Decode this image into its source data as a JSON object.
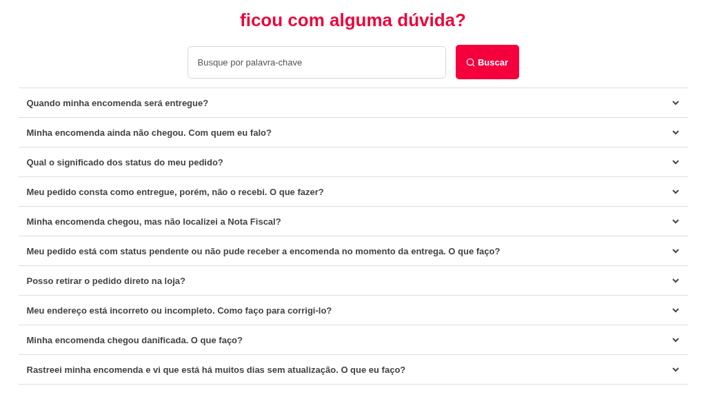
{
  "title": "ficou com alguma dúvida?",
  "search": {
    "placeholder": "Busque por palavra-chave",
    "button": "Buscar"
  },
  "faq": [
    {
      "question": "Quando minha encomenda será entregue?"
    },
    {
      "question": "Minha encomenda ainda não chegou. Com quem eu falo?"
    },
    {
      "question": "Qual o significado dos status do meu pedido?"
    },
    {
      "question": "Meu pedido consta como entregue, porém, não o recebi. O que fazer?"
    },
    {
      "question": "Minha encomenda chegou, mas não localizei a Nota Fiscal?"
    },
    {
      "question": "Meu pedido está com status pendente ou não pude receber a encomenda no momento da entrega. O que faço?"
    },
    {
      "question": "Posso retirar o pedido direto na loja?"
    },
    {
      "question": "Meu endereço está incorreto ou incompleto. Como faço para corrigi-lo?"
    },
    {
      "question": "Minha encomenda chegou danificada. O que faço?"
    },
    {
      "question": "Rastreei minha encomenda e vi que está há muitos dias sem atualização. O que eu faço?"
    }
  ]
}
